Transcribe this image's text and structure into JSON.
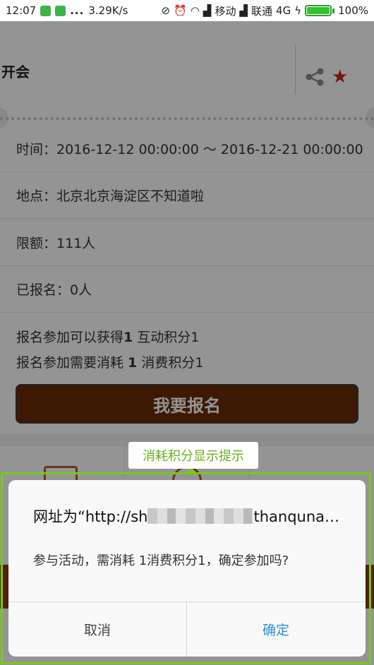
{
  "status_bar": {
    "time": "12:07",
    "speed": "3.29K/s",
    "carrier1": "移动",
    "carrier2": "联通",
    "network": "4G",
    "battery": "100%"
  },
  "event": {
    "title": "开会"
  },
  "rows": {
    "time_label": "时间：",
    "time_value": "2016-12-12 00:00:00 ～ 2016-12-21 00:00:00",
    "place_label": "地点：",
    "place_value": "北京北京海淀区不知道啦",
    "quota_label": "限额：",
    "quota_value": "111人",
    "enrolled_label": "已报名：",
    "enrolled_value": "0人"
  },
  "points": {
    "gain_prefix": "报名参加可以获得",
    "gain_num": "1",
    "gain_suffix": " 互动积分1",
    "cost_prefix": "报名参加需要消耗 ",
    "cost_num": "1",
    "cost_suffix": " 消费积分1"
  },
  "signup_button": "我要报名",
  "annotation": {
    "label": "消耗积分显示提示",
    "color": "#79c81f"
  },
  "dialog": {
    "title_prefix": "网址为“http://sh",
    "title_suffix": "thanquna…",
    "message": "参与活动，需消耗 1消费积分1，确定参加吗?",
    "cancel": "取消",
    "confirm": "确定"
  },
  "icons": {
    "share": "share-icon",
    "favorite": "star-icon"
  },
  "colors": {
    "accent_brown": "#6a2a06",
    "favorite_red": "#c9211e",
    "confirm_blue": "#2a90d8"
  }
}
